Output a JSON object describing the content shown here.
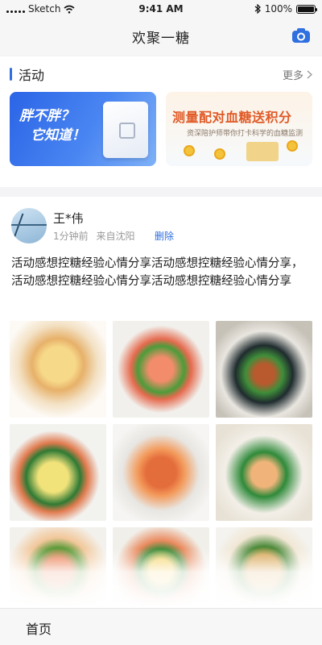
{
  "status_bar": {
    "carrier": "Sketch",
    "time": "9:41 AM",
    "battery_percent": "100%",
    "battery_level": 1.0
  },
  "nav": {
    "title": "欢聚一糖",
    "camera_icon": "camera-icon"
  },
  "activity": {
    "title": "活动",
    "more": "更多",
    "banners": [
      {
        "line1": "胖不胖？",
        "line2": "它知道！"
      },
      {
        "title": "测量配对血糖送积分",
        "subtitle": "资深陪护师带你打卡科学的血糖监测"
      }
    ]
  },
  "post": {
    "user_name": "王*伟",
    "time_ago": "1分钟前",
    "location": "来自沈阳",
    "delete_label": "删除",
    "text": "活动感想控糖经验心情分享活动感想控糖经验心情分享，活动感想控糖经验心情分享活动感想控糖经验心情分享",
    "photos": [
      {
        "name": "toast-sandwich-photo"
      },
      {
        "name": "salmon-salad-photo"
      },
      {
        "name": "vegetable-plate-photo"
      },
      {
        "name": "egg-avocado-salad-photo"
      },
      {
        "name": "shrimp-pasta-photo"
      },
      {
        "name": "salmon-broccoli-photo"
      },
      {
        "name": "shrimp-avocado-photo"
      },
      {
        "name": "fresh-salad-photo"
      },
      {
        "name": "grain-bowl-photo"
      }
    ]
  },
  "tab_bar": {
    "home_label": "首页"
  },
  "colors": {
    "accent": "#2f6fe0",
    "banner_orange": "#e05a26"
  }
}
